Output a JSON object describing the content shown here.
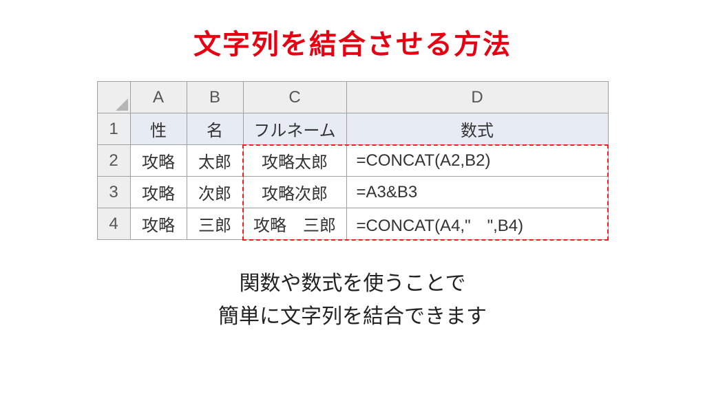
{
  "title": "文字列を結合させる方法",
  "columns": {
    "A": "A",
    "B": "B",
    "C": "C",
    "D": "D"
  },
  "rowNumbers": [
    "1",
    "2",
    "3",
    "4"
  ],
  "headerRow": {
    "A": "性",
    "B": "名",
    "C": "フルネーム",
    "D": "数式"
  },
  "rows": [
    {
      "A": "攻略",
      "B": "太郎",
      "C": "攻略太郎",
      "D": "=CONCAT(A2,B2)"
    },
    {
      "A": "攻略",
      "B": "次郎",
      "C": "攻略次郎",
      "D": "=A3&B3"
    },
    {
      "A": "攻略",
      "B": "三郎",
      "C": "攻略　三郎",
      "D": "=CONCAT(A4,\"　\",B4)"
    }
  ],
  "caption": {
    "line1": "関数や数式を使うことで",
    "line2": "簡単に文字列を結合できます"
  }
}
